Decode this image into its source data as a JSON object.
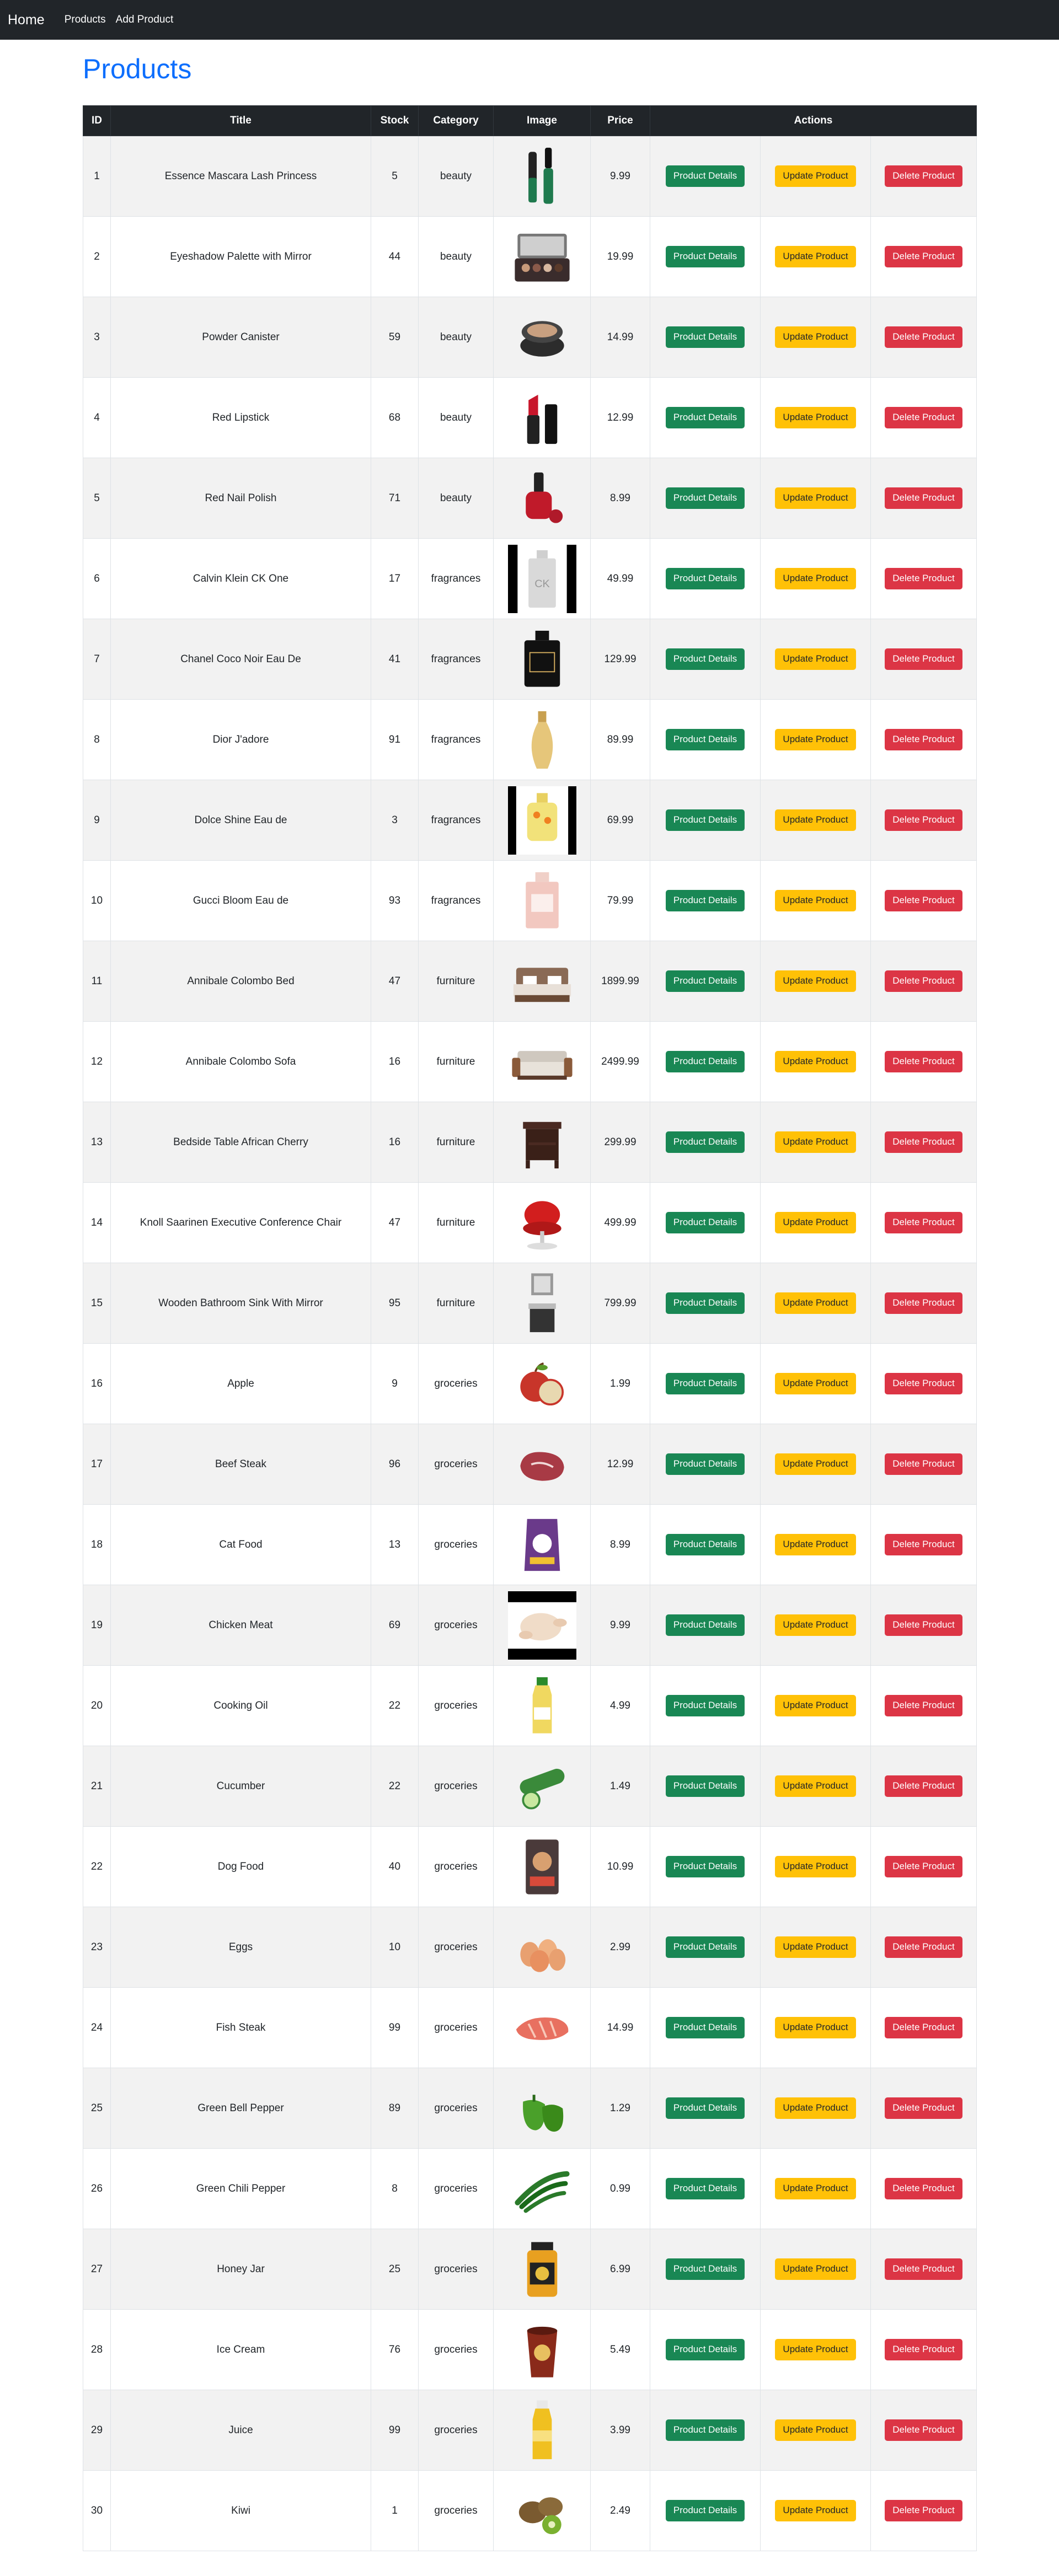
{
  "nav": {
    "brand": "Home",
    "links": [
      "Products",
      "Add Product"
    ]
  },
  "page": {
    "title": "Products"
  },
  "table": {
    "headers": {
      "id": "ID",
      "title": "Title",
      "stock": "Stock",
      "category": "Category",
      "image": "Image",
      "price": "Price",
      "actions": "Actions"
    },
    "buttons": {
      "details": "Product Details",
      "update": "Update Product",
      "delete": "Delete Product"
    },
    "rows": [
      {
        "id": "1",
        "title": "Essence Mascara Lash Princess",
        "stock": "5",
        "category": "beauty",
        "price": "9.99",
        "icon": "mascara-icon",
        "color": "#1f7a4e"
      },
      {
        "id": "2",
        "title": "Eyeshadow Palette with Mirror",
        "stock": "44",
        "category": "beauty",
        "price": "19.99",
        "icon": "palette-icon",
        "color": "#3a2c2c"
      },
      {
        "id": "3",
        "title": "Powder Canister",
        "stock": "59",
        "category": "beauty",
        "price": "14.99",
        "icon": "powder-icon",
        "color": "#2c2c2c"
      },
      {
        "id": "4",
        "title": "Red Lipstick",
        "stock": "68",
        "category": "beauty",
        "price": "12.99",
        "icon": "lipstick-icon",
        "color": "#c8162b"
      },
      {
        "id": "5",
        "title": "Red Nail Polish",
        "stock": "71",
        "category": "beauty",
        "price": "8.99",
        "icon": "nail-polish-icon",
        "color": "#c01a2a"
      },
      {
        "id": "6",
        "title": "Calvin Klein CK One",
        "stock": "17",
        "category": "fragrances",
        "price": "49.99",
        "icon": "ck-one-bottle-icon",
        "color": "#d9d9d9"
      },
      {
        "id": "7",
        "title": "Chanel Coco Noir Eau De",
        "stock": "41",
        "category": "fragrances",
        "price": "129.99",
        "icon": "chanel-bottle-icon",
        "color": "#111111"
      },
      {
        "id": "8",
        "title": "Dior J'adore",
        "stock": "91",
        "category": "fragrances",
        "price": "89.99",
        "icon": "dior-bottle-icon",
        "color": "#e6c67a"
      },
      {
        "id": "9",
        "title": "Dolce Shine Eau de",
        "stock": "3",
        "category": "fragrances",
        "price": "69.99",
        "icon": "dolce-bottle-icon",
        "color": "#f2e27a"
      },
      {
        "id": "10",
        "title": "Gucci Bloom Eau de",
        "stock": "93",
        "category": "fragrances",
        "price": "79.99",
        "icon": "gucci-bottle-icon",
        "color": "#f2c8c0"
      },
      {
        "id": "11",
        "title": "Annibale Colombo Bed",
        "stock": "47",
        "category": "furniture",
        "price": "1899.99",
        "icon": "bed-icon",
        "color": "#8a6a55"
      },
      {
        "id": "12",
        "title": "Annibale Colombo Sofa",
        "stock": "16",
        "category": "furniture",
        "price": "2499.99",
        "icon": "sofa-icon",
        "color": "#cfc8bf"
      },
      {
        "id": "13",
        "title": "Bedside Table African Cherry",
        "stock": "16",
        "category": "furniture",
        "price": "299.99",
        "icon": "bedside-table-icon",
        "color": "#4a2a22"
      },
      {
        "id": "14",
        "title": "Knoll Saarinen Executive Conference Chair",
        "stock": "47",
        "category": "furniture",
        "price": "499.99",
        "icon": "chair-icon",
        "color": "#d21e1e"
      },
      {
        "id": "15",
        "title": "Wooden Bathroom Sink With Mirror",
        "stock": "95",
        "category": "furniture",
        "price": "799.99",
        "icon": "bathroom-sink-icon",
        "color": "#333333"
      },
      {
        "id": "16",
        "title": "Apple",
        "stock": "9",
        "category": "groceries",
        "price": "1.99",
        "icon": "apple-icon",
        "color": "#c8352a"
      },
      {
        "id": "17",
        "title": "Beef Steak",
        "stock": "96",
        "category": "groceries",
        "price": "12.99",
        "icon": "steak-icon",
        "color": "#a83a45"
      },
      {
        "id": "18",
        "title": "Cat Food",
        "stock": "13",
        "category": "groceries",
        "price": "8.99",
        "icon": "cat-food-icon",
        "color": "#6a3a8a"
      },
      {
        "id": "19",
        "title": "Chicken Meat",
        "stock": "69",
        "category": "groceries",
        "price": "9.99",
        "icon": "chicken-icon",
        "color": "#f0dcc8"
      },
      {
        "id": "20",
        "title": "Cooking Oil",
        "stock": "22",
        "category": "groceries",
        "price": "4.99",
        "icon": "oil-bottle-icon",
        "color": "#f0d860"
      },
      {
        "id": "21",
        "title": "Cucumber",
        "stock": "22",
        "category": "groceries",
        "price": "1.49",
        "icon": "cucumber-icon",
        "color": "#3a8a3a"
      },
      {
        "id": "22",
        "title": "Dog Food",
        "stock": "40",
        "category": "groceries",
        "price": "10.99",
        "icon": "dog-food-icon",
        "color": "#4a3a3a"
      },
      {
        "id": "23",
        "title": "Eggs",
        "stock": "10",
        "category": "groceries",
        "price": "2.99",
        "icon": "eggs-icon",
        "color": "#e8a070"
      },
      {
        "id": "24",
        "title": "Fish Steak",
        "stock": "99",
        "category": "groceries",
        "price": "14.99",
        "icon": "fish-steak-icon",
        "color": "#e87060"
      },
      {
        "id": "25",
        "title": "Green Bell Pepper",
        "stock": "89",
        "category": "groceries",
        "price": "1.29",
        "icon": "bell-pepper-icon",
        "color": "#4aa02a"
      },
      {
        "id": "26",
        "title": "Green Chili Pepper",
        "stock": "8",
        "category": "groceries",
        "price": "0.99",
        "icon": "chili-pepper-icon",
        "color": "#2a7a2a"
      },
      {
        "id": "27",
        "title": "Honey Jar",
        "stock": "25",
        "category": "groceries",
        "price": "6.99",
        "icon": "honey-jar-icon",
        "color": "#e8a020"
      },
      {
        "id": "28",
        "title": "Ice Cream",
        "stock": "76",
        "category": "groceries",
        "price": "5.49",
        "icon": "ice-cream-icon",
        "color": "#8a2a1a"
      },
      {
        "id": "29",
        "title": "Juice",
        "stock": "99",
        "category": "groceries",
        "price": "3.99",
        "icon": "juice-icon",
        "color": "#f0c020"
      },
      {
        "id": "30",
        "title": "Kiwi",
        "stock": "1",
        "category": "groceries",
        "price": "2.49",
        "icon": "kiwi-icon",
        "color": "#7a5a30"
      }
    ]
  }
}
